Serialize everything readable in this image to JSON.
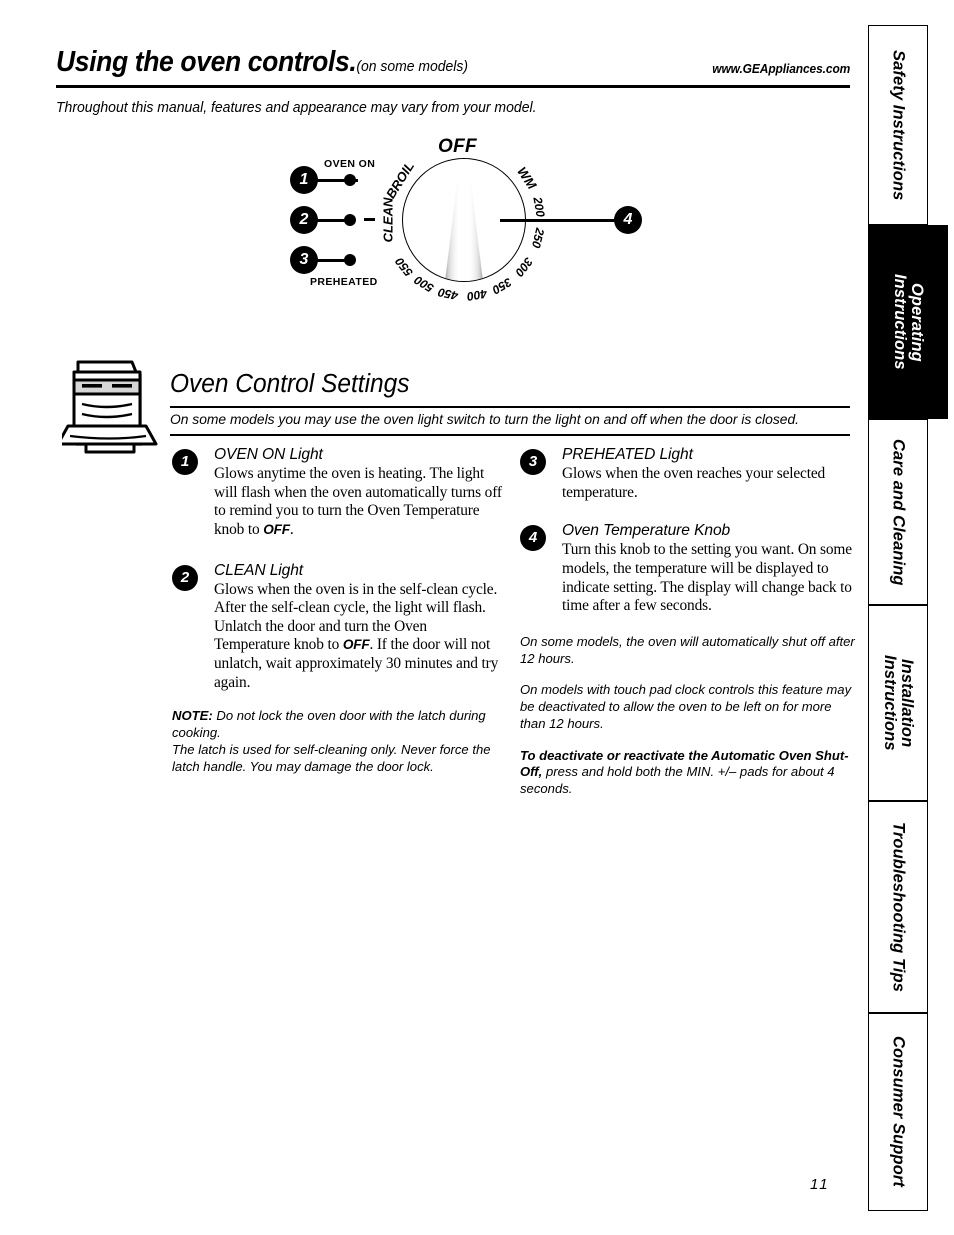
{
  "header": {
    "title": "Using the oven controls.",
    "title_suffix": "(on some models)",
    "url": "www.GEAppliances.com"
  },
  "intro": "Throughout this manual, features and appearance may vary from your model.",
  "diagram": {
    "name": "oven-control-panel-diagram",
    "dial": {
      "off_label": "OFF",
      "labels": [
        {
          "text": "BROIL",
          "angle": -58
        },
        {
          "text": "CLEAN",
          "angle": -90
        },
        {
          "text": "550",
          "angle": -128
        },
        {
          "text": "500",
          "angle": -148
        },
        {
          "text": "450",
          "angle": -168
        },
        {
          "text": "400",
          "angle": 170
        },
        {
          "text": "350",
          "angle": 150
        },
        {
          "text": "300",
          "angle": 128
        },
        {
          "text": "250",
          "angle": 104
        },
        {
          "text": "200",
          "angle": 80
        },
        {
          "text": "WM",
          "angle": 56
        }
      ]
    },
    "callouts": [
      {
        "number": "1",
        "label": "OVEN ON"
      },
      {
        "number": "2",
        "label": "CLEAN"
      },
      {
        "number": "3",
        "label": "PREHEATED"
      },
      {
        "number": "4",
        "label": ""
      }
    ]
  },
  "section": {
    "title": "Oven Control Settings",
    "lead": "On some models you may use the oven light switch to turn the light on and off when the door is closed.",
    "icon_name": "range-oven-icon"
  },
  "left_column": {
    "items": [
      {
        "number": "1",
        "heading": "OVEN ON Light",
        "body_1": "Glows anytime the oven is heating. The light will flash when the oven automatically turns off to remind you to turn the Oven Temperature knob to ",
        "body_strong": "OFF",
        "body_2": "."
      },
      {
        "number": "2",
        "heading": "CLEAN Light",
        "body_1": "Glows when the oven is in the self-clean cycle. After the self-clean cycle, the light will flash. Unlatch the door and turn the Oven Temperature knob to ",
        "body_strong": "OFF",
        "body_2": ". If the door will not unlatch, wait approximately 30 minutes and try again."
      }
    ],
    "note_label": "NOTE:",
    "note_text": " Do not lock the oven door with the latch during cooking.",
    "note_text_2": "The latch is used for self-cleaning only. Never force the latch handle. You may damage the door lock."
  },
  "right_column": {
    "items": [
      {
        "number": "3",
        "heading": "PREHEATED Light",
        "body_1": "Glows when the oven reaches your selected temperature.",
        "body_strong": "",
        "body_2": ""
      },
      {
        "number": "4",
        "heading": "Oven Temperature Knob",
        "body_1": "Turn this knob to the setting you want. On some models, the temperature will be displayed to indicate setting. The display will change back to time after a few seconds.",
        "body_strong": "",
        "body_2": ""
      }
    ],
    "note_1": "On some models, the oven will automatically shut off after 12 hours.",
    "note_2": "On models with touch pad clock controls this feature may be deactivated to allow the oven to be left on for more than 12 hours.",
    "note_3_bold": "To deactivate or reactivate the Automatic Oven Shut-Off,",
    "note_3_rest": " press and hold both the MIN. +/– pads for about 4 seconds."
  },
  "rail": {
    "tabs": [
      {
        "label": "Safety Instructions",
        "active": false
      },
      {
        "label": "Operating\nInstructions",
        "active": true
      },
      {
        "label": "Care and Cleaning",
        "active": false
      },
      {
        "label": "Installation\nInstructions",
        "active": false
      },
      {
        "label": "Troubleshooting Tips",
        "active": false
      },
      {
        "label": "Consumer Support",
        "active": false
      }
    ]
  },
  "page_number": "11"
}
